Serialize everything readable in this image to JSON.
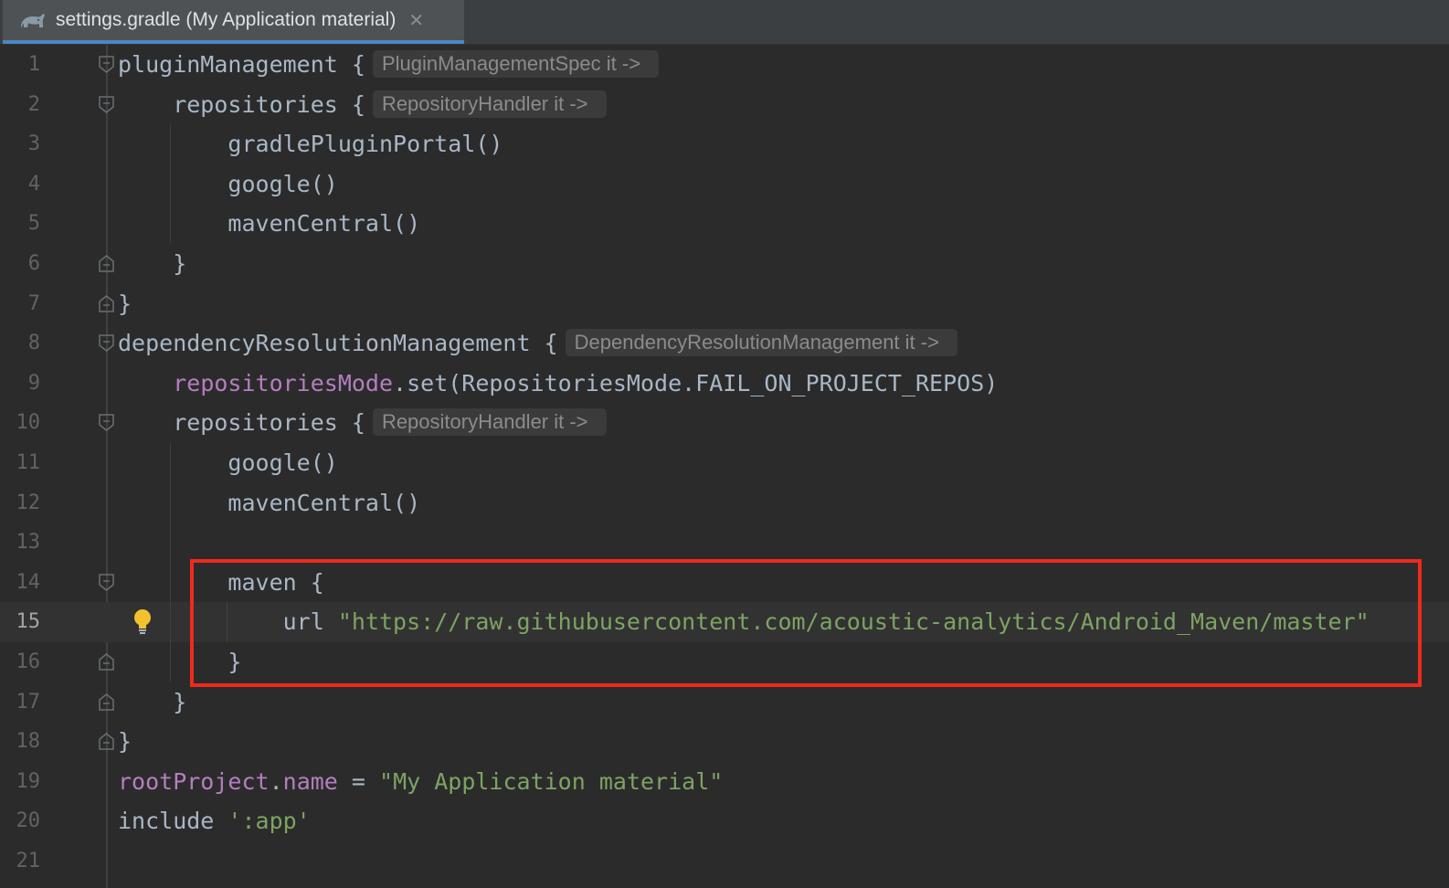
{
  "tab": {
    "title": "settings.gradle (My Application material)",
    "icon": "gradle-elephant-icon",
    "close_icon": "close-icon"
  },
  "colors": {
    "accent": "#4a88c7",
    "highlight_box": "#f0291c",
    "string": "#7ea362",
    "property": "#b57ebf"
  },
  "lines": [
    {
      "n": "1",
      "code": "pluginManagement {",
      "hint": "PluginManagementSpec it ->"
    },
    {
      "n": "2",
      "code": "    repositories {",
      "hint": "RepositoryHandler it ->"
    },
    {
      "n": "3",
      "code": "        gradlePluginPortal()"
    },
    {
      "n": "4",
      "code": "        google()"
    },
    {
      "n": "5",
      "code": "        mavenCentral()"
    },
    {
      "n": "6",
      "code": "    }"
    },
    {
      "n": "7",
      "code": "}"
    },
    {
      "n": "8",
      "code": "dependencyResolutionManagement {",
      "hint": "DependencyResolutionManagement it ->"
    },
    {
      "n": "9",
      "code_prop": "repositoriesMode",
      "code_rest": ".set(RepositoriesMode.FAIL_ON_PROJECT_REPOS)"
    },
    {
      "n": "10",
      "code": "    repositories {",
      "hint": "RepositoryHandler it ->"
    },
    {
      "n": "11",
      "code": "        google()"
    },
    {
      "n": "12",
      "code": "        mavenCentral()"
    },
    {
      "n": "13",
      "code": ""
    },
    {
      "n": "14",
      "code": "        maven {"
    },
    {
      "n": "15",
      "code_kw": "url ",
      "code_str": "\"https://raw.githubusercontent.com/acoustic-analytics/Android_Maven/master\""
    },
    {
      "n": "16",
      "code": "        }"
    },
    {
      "n": "17",
      "code": "    }"
    },
    {
      "n": "18",
      "code": "}"
    },
    {
      "n": "19",
      "code_prop": "rootProject",
      "code_mid": ".",
      "code_prop2": "name",
      "code_rest": " = ",
      "code_str": "\"My Application material\""
    },
    {
      "n": "20",
      "code_kw": "include ",
      "code_str": "':app'"
    },
    {
      "n": "21",
      "code": ""
    }
  ]
}
